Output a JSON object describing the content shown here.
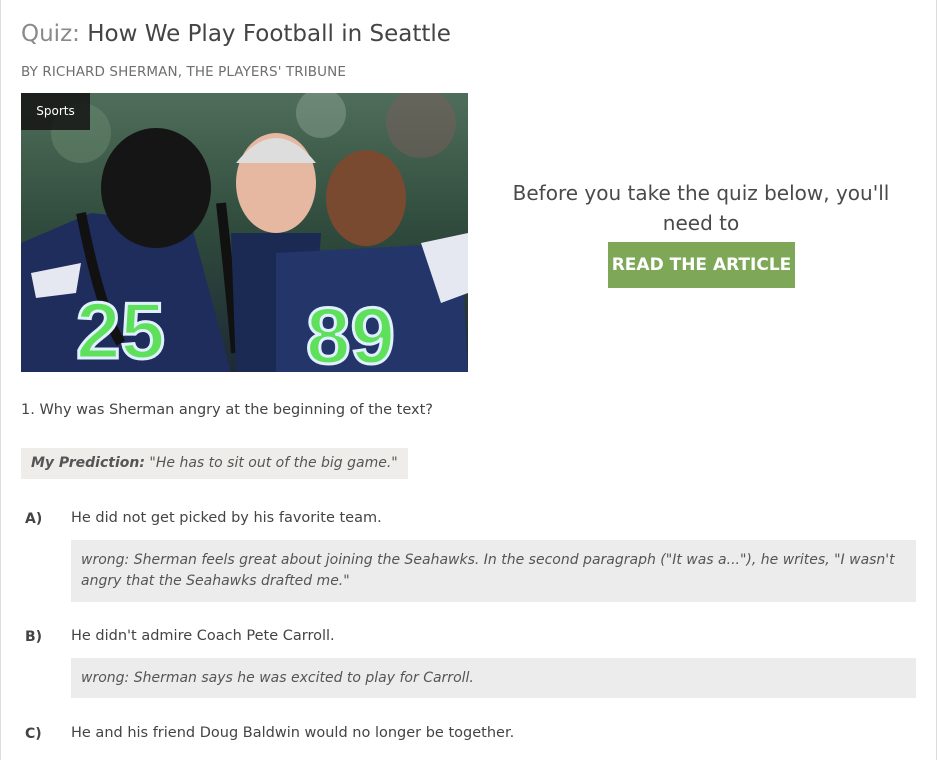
{
  "header": {
    "title_prefix": "Quiz:",
    "title_main": "How We Play Football in Seattle",
    "byline": "BY RICHARD SHERMAN, THE PLAYERS' TRIBUNE"
  },
  "image": {
    "tag": "Sports",
    "alt": "Seahawks players 25 and 89 with coach"
  },
  "cta": {
    "text": "Before you take the quiz below, you'll need to",
    "button_label": "READ THE ARTICLE",
    "button_color": "#7ea857"
  },
  "question": {
    "text": "1. Why was Sherman angry at the beginning of the text?",
    "prediction_label": "My Prediction:",
    "prediction_text": "\"He has to sit out of the big game.\""
  },
  "options": [
    {
      "letter": "A)",
      "text": "He did not get picked by his favorite team.",
      "feedback": "wrong: Sherman feels great about joining the Seahawks. In the second paragraph (\"It was a...\"), he writes, \"I wasn't angry that the Seahawks drafted me.\""
    },
    {
      "letter": "B)",
      "text": "He didn't admire Coach Pete Carroll.",
      "feedback": "wrong: Sherman says he was excited to play for Carroll."
    },
    {
      "letter": "C)",
      "text": "He and his friend Doug Baldwin would no longer be together.",
      "feedback": ""
    }
  ]
}
